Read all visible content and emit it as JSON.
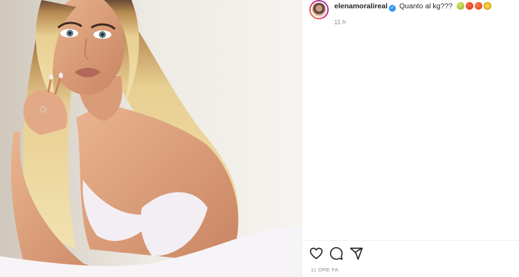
{
  "post": {
    "username": "elenamoralireal",
    "verified_icon": "verified-badge-icon",
    "caption": "Quanto al kg???",
    "caption_emojis": [
      "pear-emoji",
      "tomato-emoji",
      "tomato-emoji",
      "drooling-face-emoji"
    ],
    "posted_relative": "11 h",
    "posted_full": "11 ORE FA"
  },
  "actions": {
    "icons": [
      "heart-icon",
      "comment-icon",
      "share-icon"
    ]
  },
  "colors": {
    "text": "#262626",
    "muted": "#8e8e8e",
    "verified": "#3897f0",
    "divider": "#efefef"
  }
}
